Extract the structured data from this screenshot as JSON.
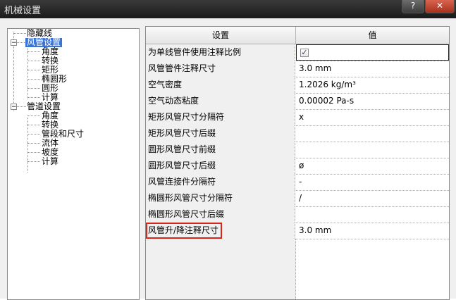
{
  "window": {
    "title": "机械设置",
    "help_label": "?",
    "close_label": "✕"
  },
  "tree": {
    "items": [
      {
        "label": "隐藏线"
      },
      {
        "label": "风管设置",
        "selected": true,
        "expanded": true
      },
      {
        "label": "角度"
      },
      {
        "label": "转换"
      },
      {
        "label": "矩形"
      },
      {
        "label": "椭圆形"
      },
      {
        "label": "圆形"
      },
      {
        "label": "计算"
      },
      {
        "label": "管道设置",
        "expanded": true
      },
      {
        "label": "角度"
      },
      {
        "label": "转换"
      },
      {
        "label": "管段和尺寸"
      },
      {
        "label": "流体"
      },
      {
        "label": "坡度"
      },
      {
        "label": "计算"
      }
    ],
    "expander_symbol": "−"
  },
  "grid": {
    "headers": [
      "设置",
      "值"
    ],
    "rows": [
      {
        "name": "为单线管件使用注释比例",
        "value": "",
        "checked": true
      },
      {
        "name": "风管管件注释尺寸",
        "value": "3.0 mm"
      },
      {
        "name": "空气密度",
        "value": "1.2026 kg/m³"
      },
      {
        "name": "空气动态粘度",
        "value": "0.00002 Pa-s"
      },
      {
        "name": "矩形风管尺寸分隔符",
        "value": "x"
      },
      {
        "name": "矩形风管尺寸后缀",
        "value": ""
      },
      {
        "name": "圆形风管尺寸前缀",
        "value": ""
      },
      {
        "name": "圆形风管尺寸后缀",
        "value": "ø"
      },
      {
        "name": "风管连接件分隔符",
        "value": "-"
      },
      {
        "name": "椭圆形风管尺寸分隔符",
        "value": "/"
      },
      {
        "name": "椭圆形风管尺寸后缀",
        "value": ""
      },
      {
        "name": "风管升/降注释尺寸",
        "value": "3.0 mm",
        "highlighted": true
      }
    ],
    "checkbox_mark": "✓",
    "highlight_color": "#d9261c"
  }
}
